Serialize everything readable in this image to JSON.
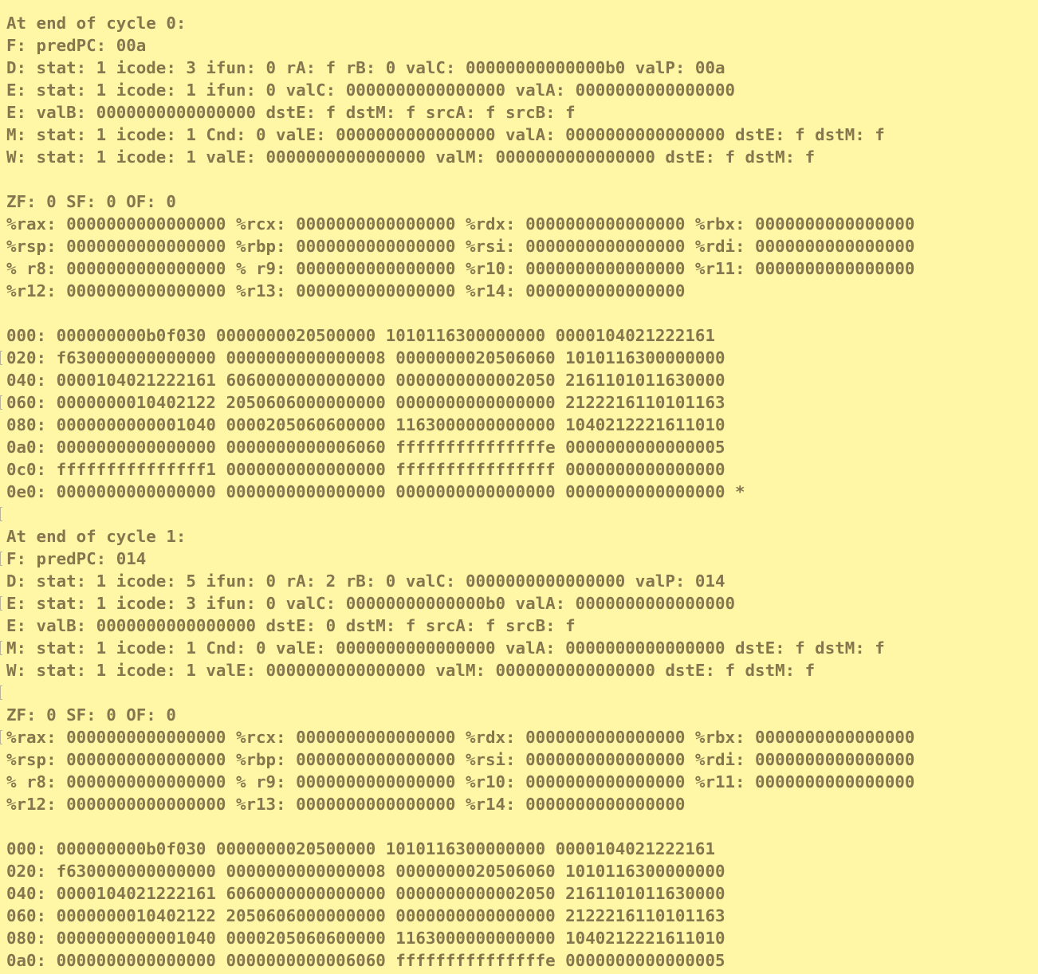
{
  "terminal": {
    "lines": [
      "At end of cycle 0:",
      "F: predPC: 00a",
      "D: stat: 1 icode: 3 ifun: 0 rA: f rB: 0 valC: 00000000000000b0 valP: 00a",
      "E: stat: 1 icode: 1 ifun: 0 valC: 0000000000000000 valA: 0000000000000000",
      "E: valB: 0000000000000000 dstE: f dstM: f srcA: f srcB: f",
      "M: stat: 1 icode: 1 Cnd: 0 valE: 0000000000000000 valA: 0000000000000000 dstE: f dstM: f",
      "W: stat: 1 icode: 1 valE: 0000000000000000 valM: 0000000000000000 dstE: f dstM: f",
      "",
      "ZF: 0 SF: 0 OF: 0",
      "%rax: 0000000000000000 %rcx: 0000000000000000 %rdx: 0000000000000000 %rbx: 0000000000000000",
      "%rsp: 0000000000000000 %rbp: 0000000000000000 %rsi: 0000000000000000 %rdi: 0000000000000000",
      "% r8: 0000000000000000 % r9: 0000000000000000 %r10: 0000000000000000 %r11: 0000000000000000",
      "%r12: 0000000000000000 %r13: 0000000000000000 %r14: 0000000000000000",
      "",
      "000: 000000000b0f030 0000000020500000 1010116300000000 0000104021222161",
      "020: f630000000000000 0000000000000008 0000000020506060 1010116300000000",
      "040: 0000104021222161 6060000000000000 0000000000002050 2161101011630000",
      "060: 0000000010402122 2050606000000000 0000000000000000 2122216110101163",
      "080: 0000000000001040 0000205060600000 1163000000000000 1040212221611010",
      "0a0: 0000000000000000 0000000000006060 fffffffffffffffe 0000000000000005",
      "0c0: fffffffffffffff1 0000000000000000 ffffffffffffffff 0000000000000000",
      "0e0: 0000000000000000 0000000000000000 0000000000000000 0000000000000000 *",
      "",
      "At end of cycle 1:",
      "F: predPC: 014",
      "D: stat: 1 icode: 5 ifun: 0 rA: 2 rB: 0 valC: 0000000000000000 valP: 014",
      "E: stat: 1 icode: 3 ifun: 0 valC: 00000000000000b0 valA: 0000000000000000",
      "E: valB: 0000000000000000 dstE: 0 dstM: f srcA: f srcB: f",
      "M: stat: 1 icode: 1 Cnd: 0 valE: 0000000000000000 valA: 0000000000000000 dstE: f dstM: f",
      "W: stat: 1 icode: 1 valE: 0000000000000000 valM: 0000000000000000 dstE: f dstM: f",
      "",
      "ZF: 0 SF: 0 OF: 0",
      "%rax: 0000000000000000 %rcx: 0000000000000000 %rdx: 0000000000000000 %rbx: 0000000000000000",
      "%rsp: 0000000000000000 %rbp: 0000000000000000 %rsi: 0000000000000000 %rdi: 0000000000000000",
      "% r8: 0000000000000000 % r9: 0000000000000000 %r10: 0000000000000000 %r11: 0000000000000000",
      "%r12: 0000000000000000 %r13: 0000000000000000 %r14: 0000000000000000",
      "",
      "000: 000000000b0f030 0000000020500000 1010116300000000 0000104021222161",
      "020: f630000000000000 0000000000000008 0000000020506060 1010116300000000",
      "040: 0000104021222161 6060000000000000 0000000000002050 2161101011630000",
      "060: 0000000010402122 2050606000000000 0000000000000000 2122216110101163",
      "080: 0000000000001040 0000205060600000 1163000000000000 1040212221611010",
      "0a0: 0000000000000000 0000000000006060 fffffffffffffffe 0000000000000005"
    ],
    "colors": {
      "background": "#fff7a6",
      "text": "#87754e",
      "marker": "#b9b39b"
    }
  }
}
